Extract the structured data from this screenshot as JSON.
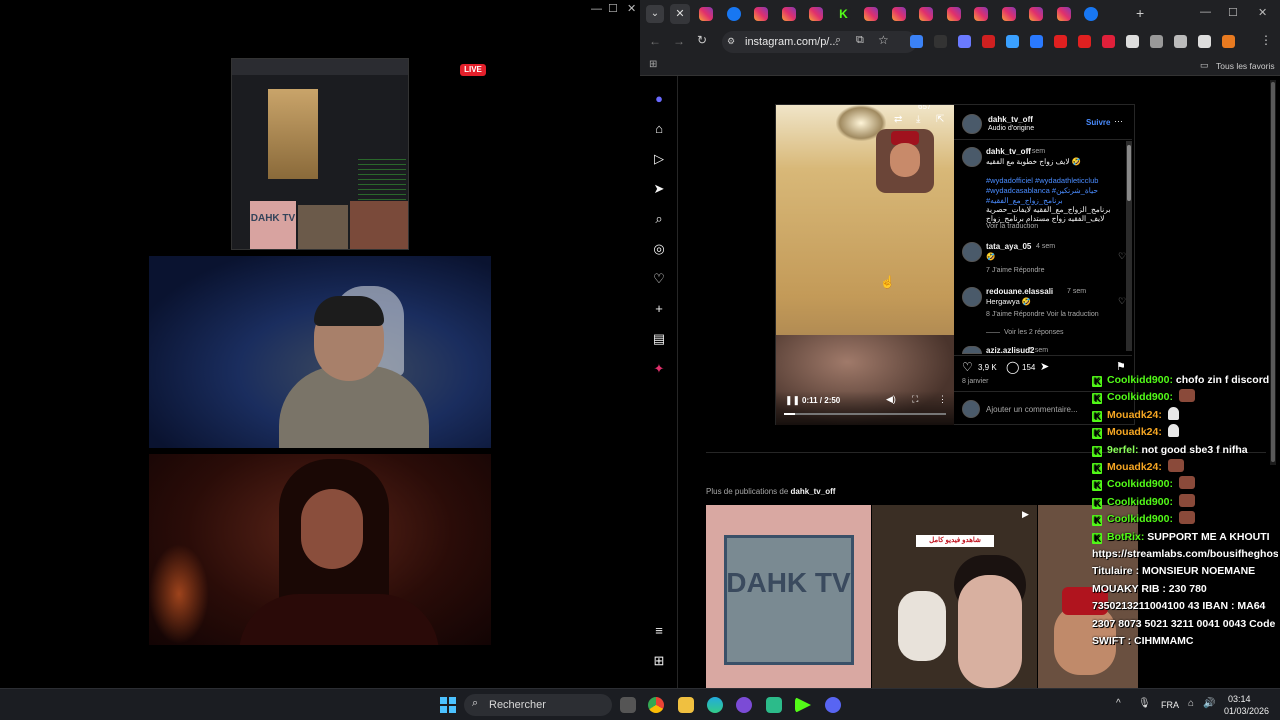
{
  "left_window": {
    "controls": [
      "—",
      "☐",
      "✕"
    ],
    "live_badge": "LIVE",
    "mini_tile_text": "DAHK TV"
  },
  "browser": {
    "url": "instagram.com/p/...",
    "bookmarks_label": "Tous les favoris",
    "tab_icons": [
      "instagram",
      "facebook",
      "instagram",
      "instagram",
      "instagram",
      "kick",
      "instagram",
      "instagram",
      "instagram",
      "instagram",
      "instagram",
      "instagram",
      "instagram",
      "instagram",
      "facebook"
    ],
    "new_tab": "+",
    "window_controls": [
      "—",
      "☐",
      "✕"
    ]
  },
  "post": {
    "counter": "657",
    "author": "dahk_tv_off",
    "audio": "Audio d'origine",
    "follow": "Suivre",
    "more": "···",
    "caption_user": "dahk_tv_off",
    "caption_time": "7 sem",
    "caption_text": "لايف زواج خطوبة مع الفقيه 🤣",
    "hashtags_1": "#wydadofficiel #wydadathleticclub",
    "hashtags_2": "#wydadcasablanca #حياة_شرتكين",
    "hashtags_3": "#برنامج_زواج_مع_الفقيه",
    "caption_ar_1": "برنامج_الزواج_مع_الفقيه لايفات_حصرية",
    "caption_ar_2": "لايف_الفقيه زواج مستدام برنامج_زواج",
    "see_translation": "Voir la traduction",
    "comments": [
      {
        "user": "tata_aya_05",
        "time": "4 sem",
        "text": "🤣",
        "meta": "7 J'aime   Répondre"
      },
      {
        "user": "redouane.elassali",
        "time": "7 sem",
        "text": "Hergawya 🤣",
        "meta": "8 J'aime   Répondre   Voir la traduction"
      },
      {
        "user": "aziz.azlisud2",
        "time": "5 sem",
        "text": "",
        "meta": ""
      }
    ],
    "view_replies": "Voir les 2 réponses",
    "likes": "3,9 K",
    "comment_count": "154",
    "date": "8 janvier",
    "add_comment": "Ajouter un commentaire...",
    "video_time": "0:11 / 2:50",
    "video_progress": 0.066
  },
  "more_posts": {
    "prefix": "Plus de publications de",
    "user": "dahk_tv_off",
    "tile1": "DAHK TV",
    "tile2_banner": "شاهدو فيديو كامل"
  },
  "chat": [
    {
      "user": "Coolkidd900",
      "color": "#53fc18",
      "text": "chofo zin f discord",
      "emote": false
    },
    {
      "user": "Coolkidd900",
      "color": "#53fc18",
      "text": "",
      "emote": true
    },
    {
      "user": "Mouadk24",
      "color": "#f5a623",
      "text": "",
      "emote": true
    },
    {
      "user": "Mouadk24",
      "color": "#f5a623",
      "text": "",
      "emote": true
    },
    {
      "user": "9erfel",
      "color": "#8aff5a",
      "text": "not good sbe3 f nifha",
      "emote": false
    },
    {
      "user": "Mouadk24",
      "color": "#f5a623",
      "text": "",
      "emote": true
    },
    {
      "user": "Coolkidd900",
      "color": "#53fc18",
      "text": "",
      "emote": true
    },
    {
      "user": "Coolkidd900",
      "color": "#53fc18",
      "text": "",
      "emote": true
    },
    {
      "user": "Coolkidd900",
      "color": "#53fc18",
      "text": "",
      "emote": true
    },
    {
      "user": "BotRix",
      "color": "#53fc18",
      "text": "SUPPORT ME A KHOUTI https://streamlabs.com/bousifheghost/tip Titulaire : MONSIEUR NOEMANE MOUAKY RIB : 230 780 7350213211004100 43 IBAN : MA64 2307 8073 5021 3211 0041 0043 Code SWIFT : CIHMMAMC",
      "emote": false
    }
  ],
  "taskbar": {
    "search": "Rechercher",
    "lang": "FRA",
    "time": "03:14",
    "date": "01/03/2026"
  }
}
